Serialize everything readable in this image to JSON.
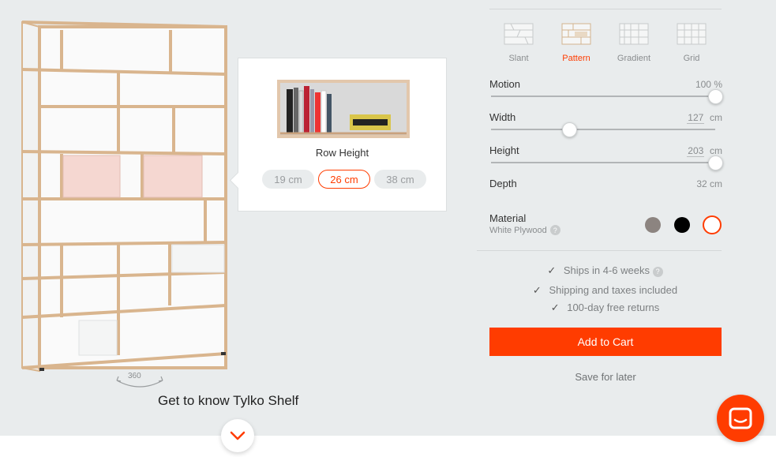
{
  "configurator": {
    "styles": [
      {
        "label": "Slant",
        "icon": "slant-shelf-icon",
        "active": false
      },
      {
        "label": "Pattern",
        "icon": "pattern-shelf-icon",
        "active": true
      },
      {
        "label": "Gradient",
        "icon": "gradient-shelf-icon",
        "active": false
      },
      {
        "label": "Grid",
        "icon": "grid-shelf-icon",
        "active": false
      }
    ],
    "motion": {
      "label": "Motion",
      "value": "100",
      "unit": "%",
      "level_percent": 100
    },
    "width": {
      "label": "Width",
      "value": "127",
      "unit": "cm",
      "level_percent": 35
    },
    "height": {
      "label": "Height",
      "value": "203",
      "unit": "cm",
      "level_percent": 100
    },
    "depth": {
      "label": "Depth",
      "value": "32 cm"
    },
    "material": {
      "label": "Material",
      "selected": "White Plywood",
      "help": "?",
      "swatches": [
        {
          "name": "grey",
          "color": "#8c8480"
        },
        {
          "name": "black",
          "color": "#000000"
        },
        {
          "name": "white",
          "color": "#ffffff",
          "selected": true
        }
      ]
    },
    "benefits": [
      {
        "text": "Ships in 4-6 weeks",
        "help": "?"
      },
      {
        "text": "Shipping and taxes included"
      },
      {
        "text": "100-day free returns"
      }
    ],
    "add_to_cart": "Add to Cart",
    "save_for_later": "Save for later"
  },
  "popover": {
    "title": "Row Height",
    "options": [
      {
        "label": "19 cm",
        "active": false
      },
      {
        "label": "26 cm",
        "active": true
      },
      {
        "label": "38 cm",
        "active": false
      }
    ]
  },
  "viewer": {
    "rotate_label": "360",
    "tagline": "Get to know Tylko Shelf"
  },
  "colors": {
    "accent": "#ff3c00",
    "background": "#e9eced",
    "highlight_row": "#f7ddd8"
  }
}
